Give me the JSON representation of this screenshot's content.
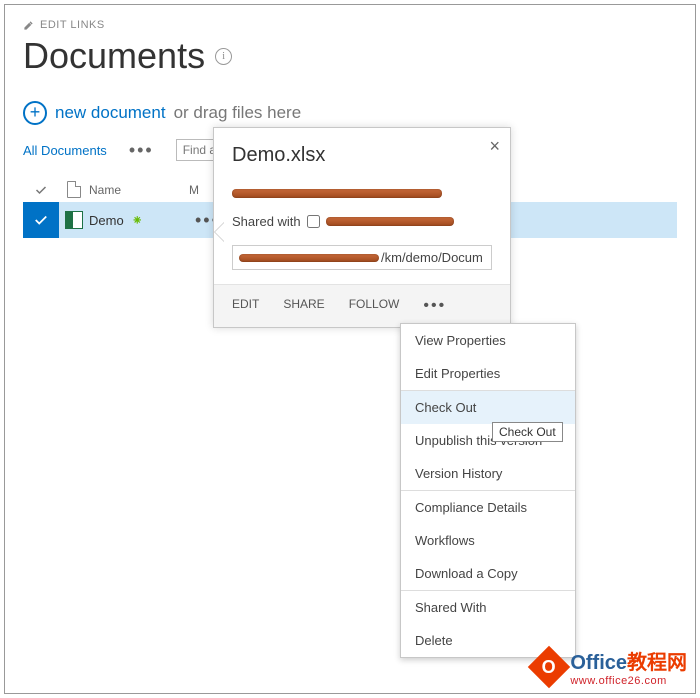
{
  "header": {
    "edit_links": "EDIT LINKS",
    "title": "Documents"
  },
  "toolbar": {
    "new_document": "new document",
    "drag_hint": "or drag files here",
    "view_name": "All Documents",
    "find_placeholder": "Find a file"
  },
  "table": {
    "col_name": "Name",
    "col_modified_initial": "M",
    "rows": [
      {
        "name": "Demo",
        "file_ext": "xlsx",
        "selected": true,
        "is_new": true
      }
    ]
  },
  "callout": {
    "title": "Demo.xlsx",
    "shared_with_label": "Shared with",
    "path_suffix": "/km/demo/Docum",
    "actions": {
      "edit": "EDIT",
      "share": "SHARE",
      "follow": "FOLLOW"
    }
  },
  "context_menu": {
    "items": [
      "View Properties",
      "Edit Properties",
      "---",
      "Check Out",
      "Unpublish this version",
      "Version History",
      "---",
      "Compliance Details",
      "Workflows",
      "Download a Copy",
      "---",
      "Shared With",
      "Delete"
    ],
    "highlighted": "Check Out"
  },
  "tooltip": "Check Out",
  "watermark": {
    "brand": "Office",
    "suffix": "教程网",
    "url": "www.office26.com"
  }
}
